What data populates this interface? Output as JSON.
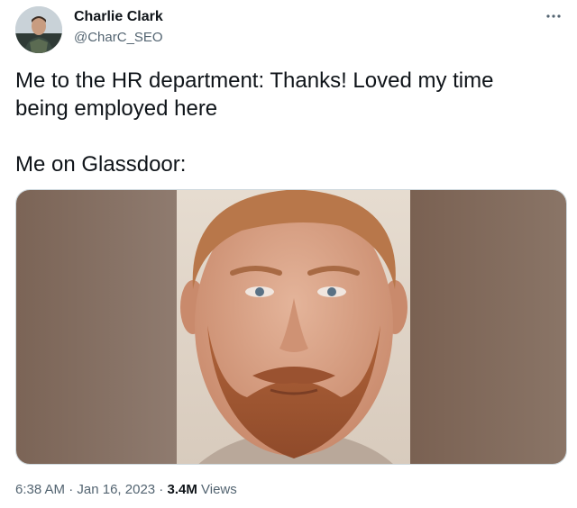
{
  "author": {
    "name": "Charlie Clark",
    "handle": "@CharC_SEO",
    "avatar_icon": "person-photo-avatar"
  },
  "more_icon": "ellipsis-icon",
  "tweet": {
    "line1": "Me to the HR department: Thanks! Loved my time",
    "line2": "being employed here",
    "line3": "Me on Glassdoor:"
  },
  "media": {
    "icon": "bearded-man-portrait-photo"
  },
  "meta": {
    "time": "6:38 AM",
    "sep1": " · ",
    "date": "Jan 16, 2023",
    "sep2": " · ",
    "views_count": "3.4M",
    "views_label": " Views"
  }
}
